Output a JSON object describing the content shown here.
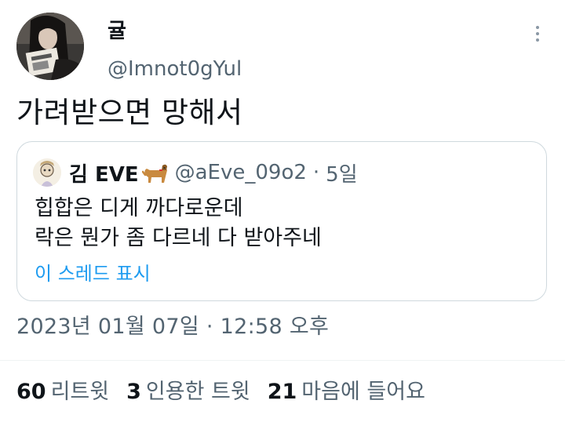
{
  "tweet": {
    "author_name": "귤",
    "author_handle": "@Imnot0gYul",
    "text": "가려받으면 망해서",
    "timestamp": "2023년 01월 07일 · 12:58 오후",
    "more_icon": "more-dots-icon"
  },
  "quoted": {
    "author_name": "김 EVE",
    "author_emoji": "dog-emoji-icon",
    "author_handle": "@aEve_09o2",
    "separator": "·",
    "time": "5일",
    "lines": [
      "힙합은 디게 까다로운데",
      "락은 뭔가 좀 다르네 다 받아주네"
    ],
    "thread_link": "이 스레드 표시"
  },
  "stats": {
    "retweets": {
      "count": "60",
      "label": "리트윗"
    },
    "quotes": {
      "count": "3",
      "label": "인용한 트윗"
    },
    "likes": {
      "count": "21",
      "label": "마음에 들어요"
    }
  },
  "colors": {
    "text": "#0f1419",
    "secondary": "#536471",
    "link": "#1d9bf0",
    "border": "#cfd9de"
  }
}
